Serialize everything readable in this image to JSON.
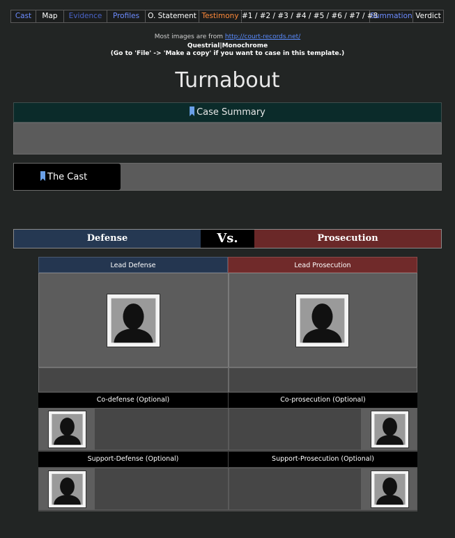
{
  "nav": {
    "items": [
      {
        "label": "Cast",
        "color": "#6d8cff"
      },
      {
        "label": "Map",
        "color": "#ffffff"
      },
      {
        "label": "Evidence",
        "color": "#4a63c8"
      },
      {
        "label": "Profiles",
        "color": "#6d8cff"
      },
      {
        "label": "O. Statement",
        "color": "#ffffff"
      },
      {
        "label": "Testimony",
        "color": "#ff8a3a"
      },
      {
        "label": "#1 / #2 / #3 / #4 / #5 / #6 / #7 / #8",
        "color": "#ffffff"
      },
      {
        "label": "Summation",
        "color": "#6d8cff"
      },
      {
        "label": "Verdict",
        "color": "#ffffff"
      }
    ]
  },
  "info": {
    "line1_prefix": "Most images are from ",
    "line1_link": "http://court-records.net/",
    "line2": "Questrial|Monochrome",
    "line3": "(Go to 'File' -> 'Make a copy' if you want to case in this template.)"
  },
  "title": "Turnabout",
  "summary": {
    "heading": "Case Summary"
  },
  "cast": {
    "heading": "The Cast"
  },
  "versus": {
    "defense": "Defense",
    "vs": "Vs.",
    "prosecution": "Prosecution"
  },
  "grid": {
    "lead_defense": "Lead Defense",
    "lead_prosecution": "Lead Prosecution",
    "co_defense": "Co-defense (Optional)",
    "co_prosecution": "Co-prosecution (Optional)",
    "support_defense": "Support-Defense (Optional)",
    "support_prosecution": "Support-Prosecution (Optional)"
  },
  "colors": {
    "background": "#222524",
    "defense": "#253852",
    "prosecution": "#6a2828",
    "summary_header": "#0b2b2a",
    "bookmark": "#6aa0e8"
  }
}
